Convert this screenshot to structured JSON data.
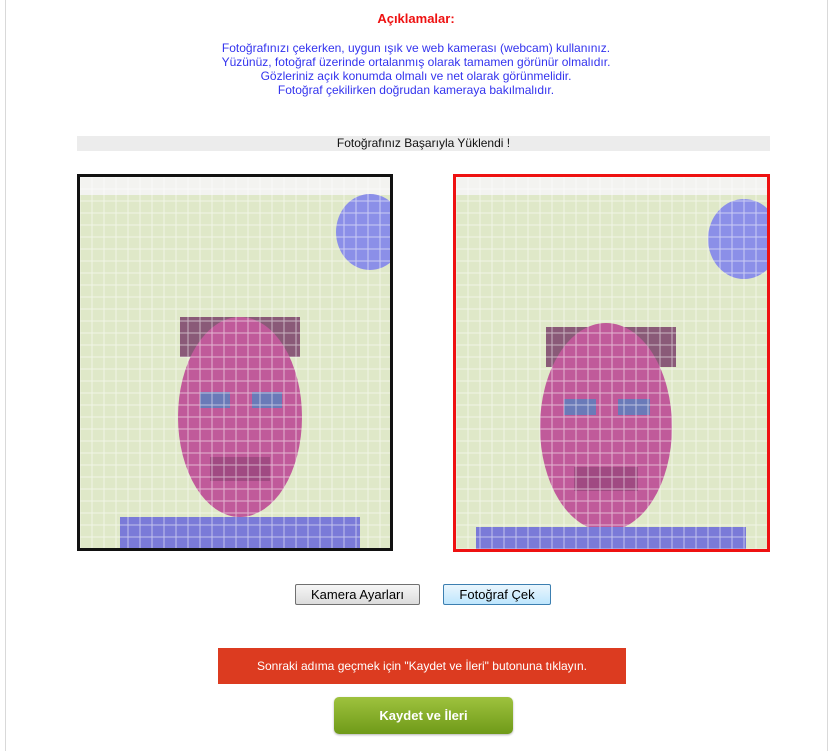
{
  "header": {
    "title": "Açıklamalar:",
    "instructions": [
      "Fotoğrafınızı çekerken, uygun ışık ve web kamerası (webcam) kullanınız.",
      "Yüzünüz, fotoğraf üzerinde ortalanmış olarak tamamen görünür olmalıdır.",
      "Gözleriniz açık konumda olmalı ve net olarak görünmelidir.",
      "Fotoğraf çekilirken doğrudan kameraya bakılmalıdır."
    ]
  },
  "status": {
    "text": "Fotoğrafınız Başarıyla Yüklendi !"
  },
  "buttons": {
    "camera_settings": "Kamera Ayarları",
    "take_photo": "Fotoğraf Çek"
  },
  "notice": {
    "text": "Sonraki adıma geçmek için \"Kaydet ve İleri\" butonuna tıklayın."
  },
  "save_button": {
    "label": "Kaydet ve İleri"
  },
  "colors": {
    "title": "#ee1111",
    "instructions": "#3333ee",
    "notice_bg": "#dc3b20",
    "save_bg": "#84ac2a",
    "live_border": "#111111",
    "captured_border": "#ee1111"
  }
}
